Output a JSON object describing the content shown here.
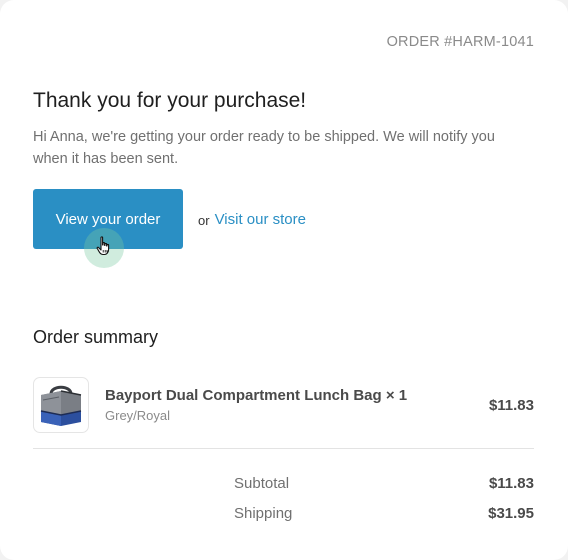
{
  "header": {
    "order_number": "ORDER #HARM-1041"
  },
  "main": {
    "heading": "Thank you for your purchase!",
    "intro": "Hi Anna, we're getting your order ready to be shipped. We will notify you when it has been sent.",
    "view_order_label": "View your order",
    "or_text": "or",
    "store_link_label": "Visit our store"
  },
  "summary": {
    "heading": "Order summary",
    "items": [
      {
        "title": "Bayport Dual Compartment Lunch Bag × 1",
        "variant": "Grey/Royal",
        "price": "$11.83",
        "thumbnail_icon": "lunch-bag-image"
      }
    ],
    "totals": [
      {
        "label": "Subtotal",
        "value": "$11.83"
      },
      {
        "label": "Shipping",
        "value": "$31.95"
      }
    ]
  },
  "colors": {
    "accent": "#2a8fc4",
    "heading_text": "#1f1f1f",
    "muted_text": "#707070"
  },
  "cursor": {
    "icon": "hand-pointer-icon"
  }
}
